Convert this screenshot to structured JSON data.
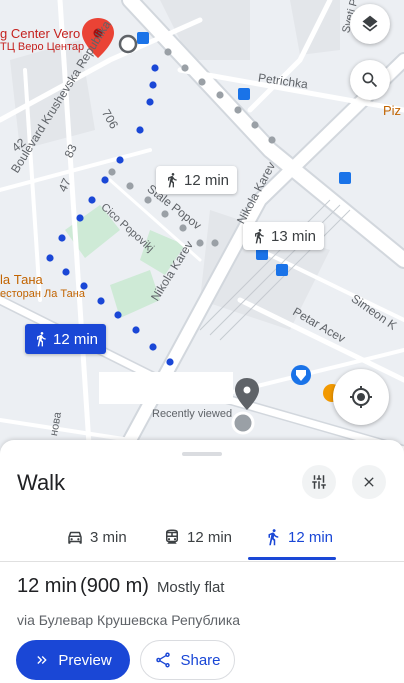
{
  "map": {
    "labels": {
      "center_vero": "g Center Vero",
      "center_vero_cyr": "ТЦ Веро Центар",
      "petrichka": "Petrichka",
      "sveti_p": "Sveti P",
      "num_706": "706",
      "num_42": "42",
      "num_83": "83",
      "num_47": "47",
      "boulevard": "Boulevard Krushevska Republika",
      "stale_popov": "Stale Popov",
      "cico_popovikj": "Cico Popovikj",
      "nikola_karev_1": "Nikola Karev",
      "nikola_karev_2": "Nikola Karev",
      "la_tana": "la Тана",
      "la_tana_cyr": "есторан Ла Тана",
      "petar_acev": "Petar Acev",
      "simeon_k": "Simeon K",
      "recently_viewed": "Recently viewed",
      "ofanova": "нова",
      "piz": "Piz"
    },
    "chips": {
      "walk_top": "12 min",
      "walk_mid": "13 min",
      "walk_selected": "12 min"
    },
    "icons": {
      "layers": "layers-icon",
      "search": "search-icon",
      "locate": "my-location-icon"
    }
  },
  "sheet": {
    "title": "Walk",
    "tabs": [
      {
        "label": "3 min",
        "icon": "car-icon"
      },
      {
        "label": "12 min",
        "icon": "transit-icon"
      },
      {
        "label": "12 min",
        "icon": "walk-icon"
      }
    ],
    "summary": {
      "time": "12 min",
      "distance": "(900 m)",
      "condition": "Mostly flat"
    },
    "via": "via Булевар Крушевска Република",
    "buttons": {
      "preview": "Preview",
      "share": "Share"
    }
  },
  "colors": {
    "accent": "#1a47d6",
    "route_alt": "#9aa0a6",
    "park": "#ceead6",
    "pin_red": "#ea4335"
  }
}
